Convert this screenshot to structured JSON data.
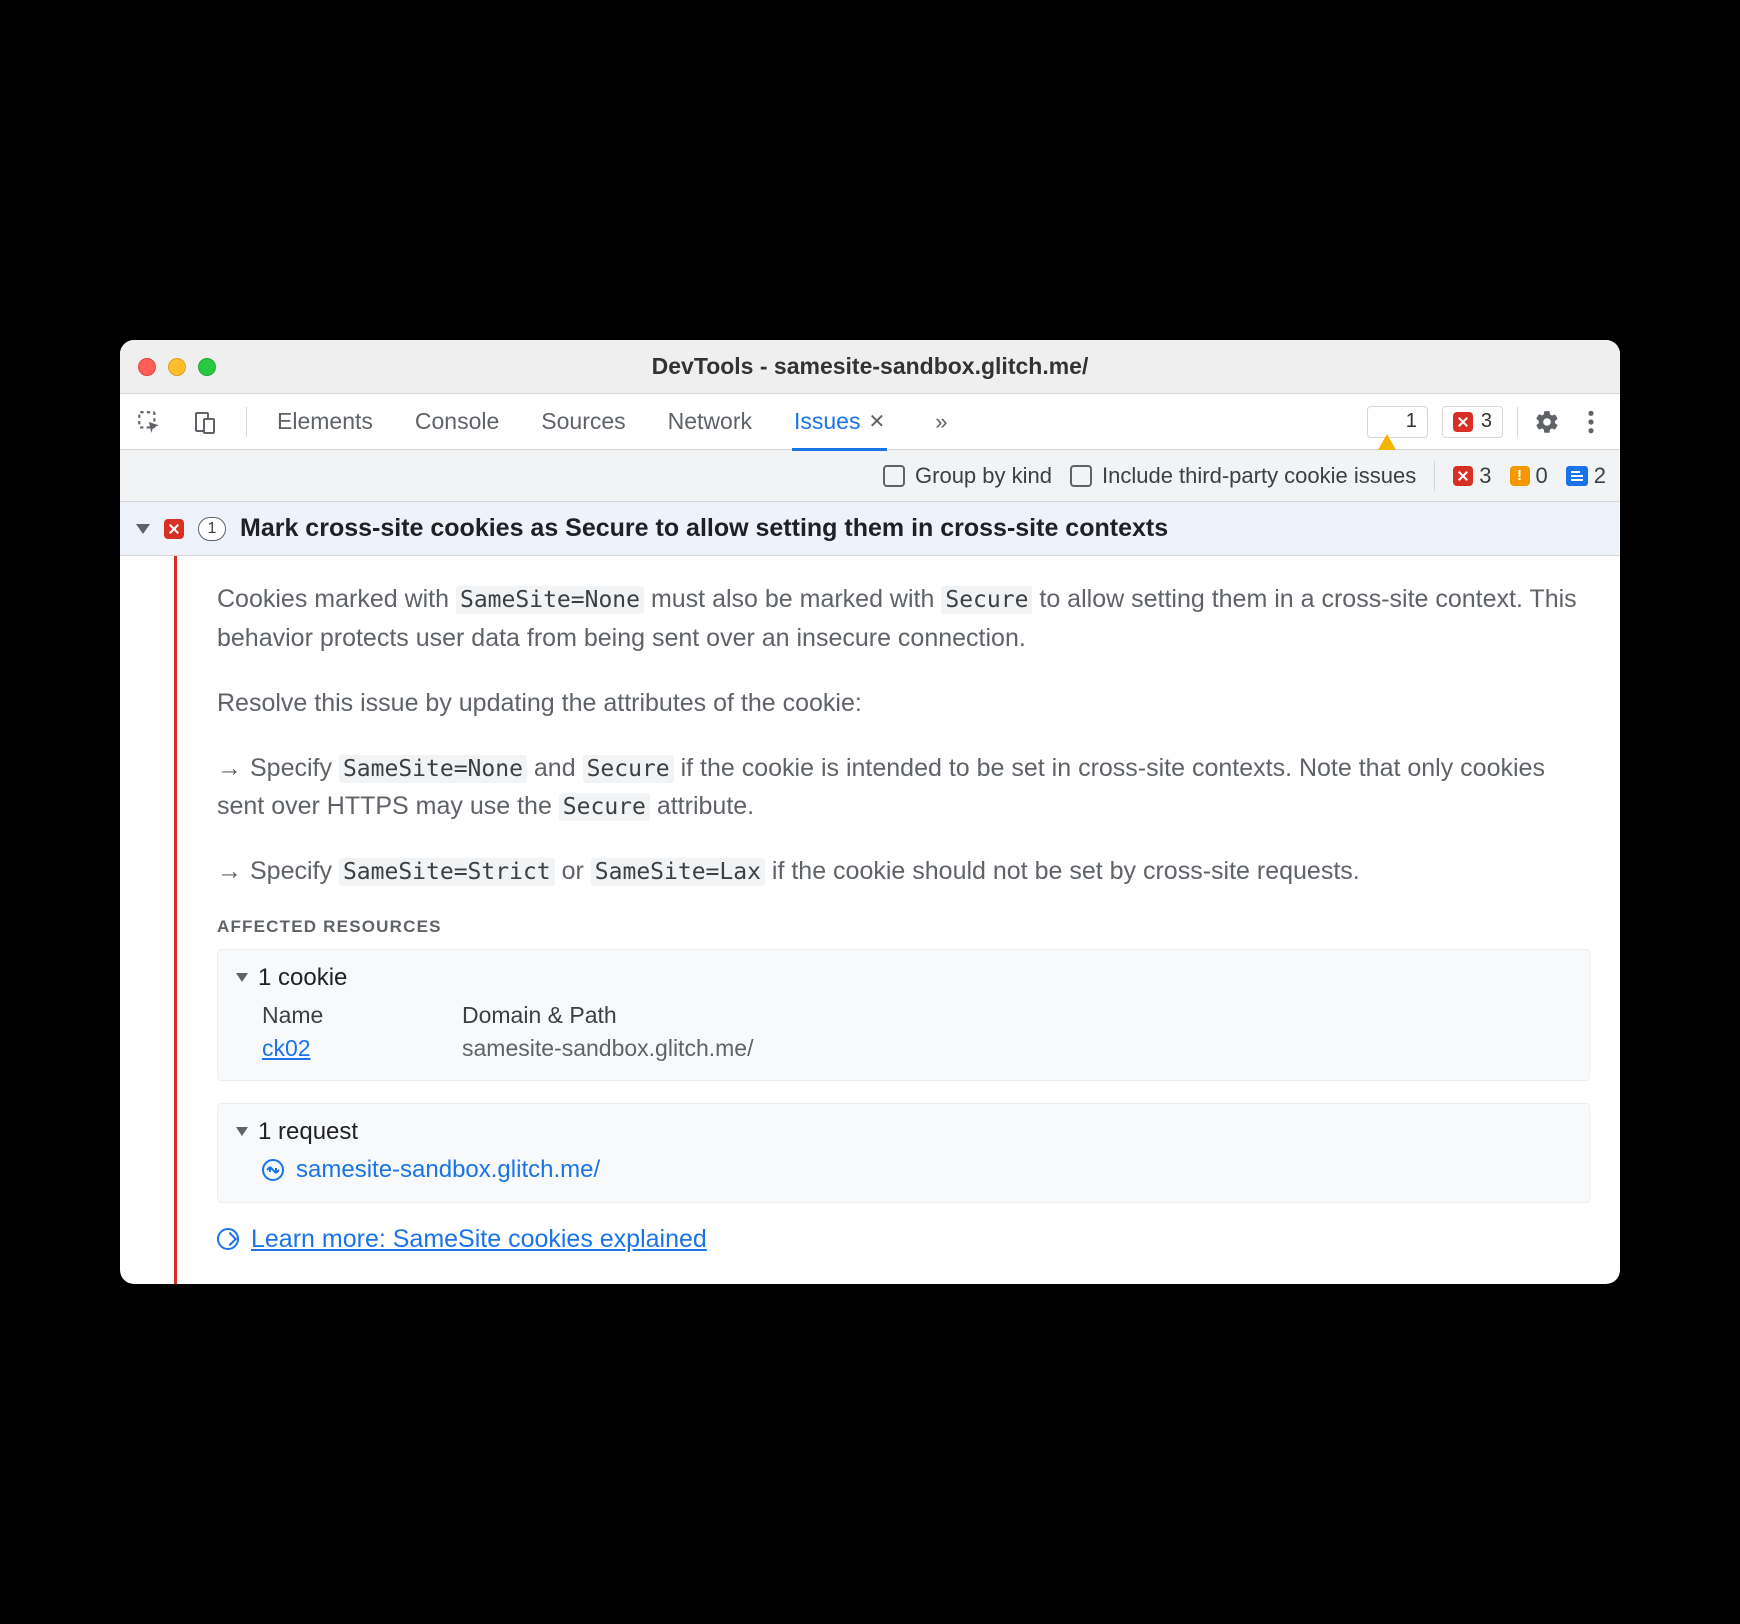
{
  "window": {
    "title": "DevTools - samesite-sandbox.glitch.me/"
  },
  "toolbar": {
    "tabs": {
      "elements": "Elements",
      "console": "Console",
      "sources": "Sources",
      "network": "Network",
      "issues": "Issues"
    },
    "warnings_count": "1",
    "errors_count": "3"
  },
  "filterbar": {
    "group_by_kind": "Group by kind",
    "include_third_party": "Include third-party cookie issues",
    "counts": {
      "error": "3",
      "warn": "0",
      "info": "2"
    }
  },
  "issue": {
    "count": "1",
    "title": "Mark cross-site cookies as Secure to allow setting them in cross-site contexts",
    "p1_a": "Cookies marked with ",
    "p1_code1": "SameSite=None",
    "p1_b": " must also be marked with ",
    "p1_code2": "Secure",
    "p1_c": " to allow setting them in a cross-site context. This behavior protects user data from being sent over an insecure connection.",
    "p2": "Resolve this issue by updating the attributes of the cookie:",
    "b1_a": "Specify ",
    "b1_code1": "SameSite=None",
    "b1_b": " and ",
    "b1_code2": "Secure",
    "b1_c": " if the cookie is intended to be set in cross-site contexts. Note that only cookies sent over HTTPS may use the ",
    "b1_code3": "Secure",
    "b1_d": " attribute.",
    "b2_a": "Specify ",
    "b2_code1": "SameSite=Strict",
    "b2_b": " or ",
    "b2_code2": "SameSite=Lax",
    "b2_c": " if the cookie should not be set by cross-site requests.",
    "affected_label": "AFFECTED RESOURCES",
    "cookies_header": "1 cookie",
    "cookies_col_name": "Name",
    "cookies_col_domain": "Domain & Path",
    "cookie_name": "ck02",
    "cookie_domain": "samesite-sandbox.glitch.me/",
    "requests_header": "1 request",
    "request_url": "samesite-sandbox.glitch.me/",
    "learn_more": "Learn more: SameSite cookies explained"
  }
}
